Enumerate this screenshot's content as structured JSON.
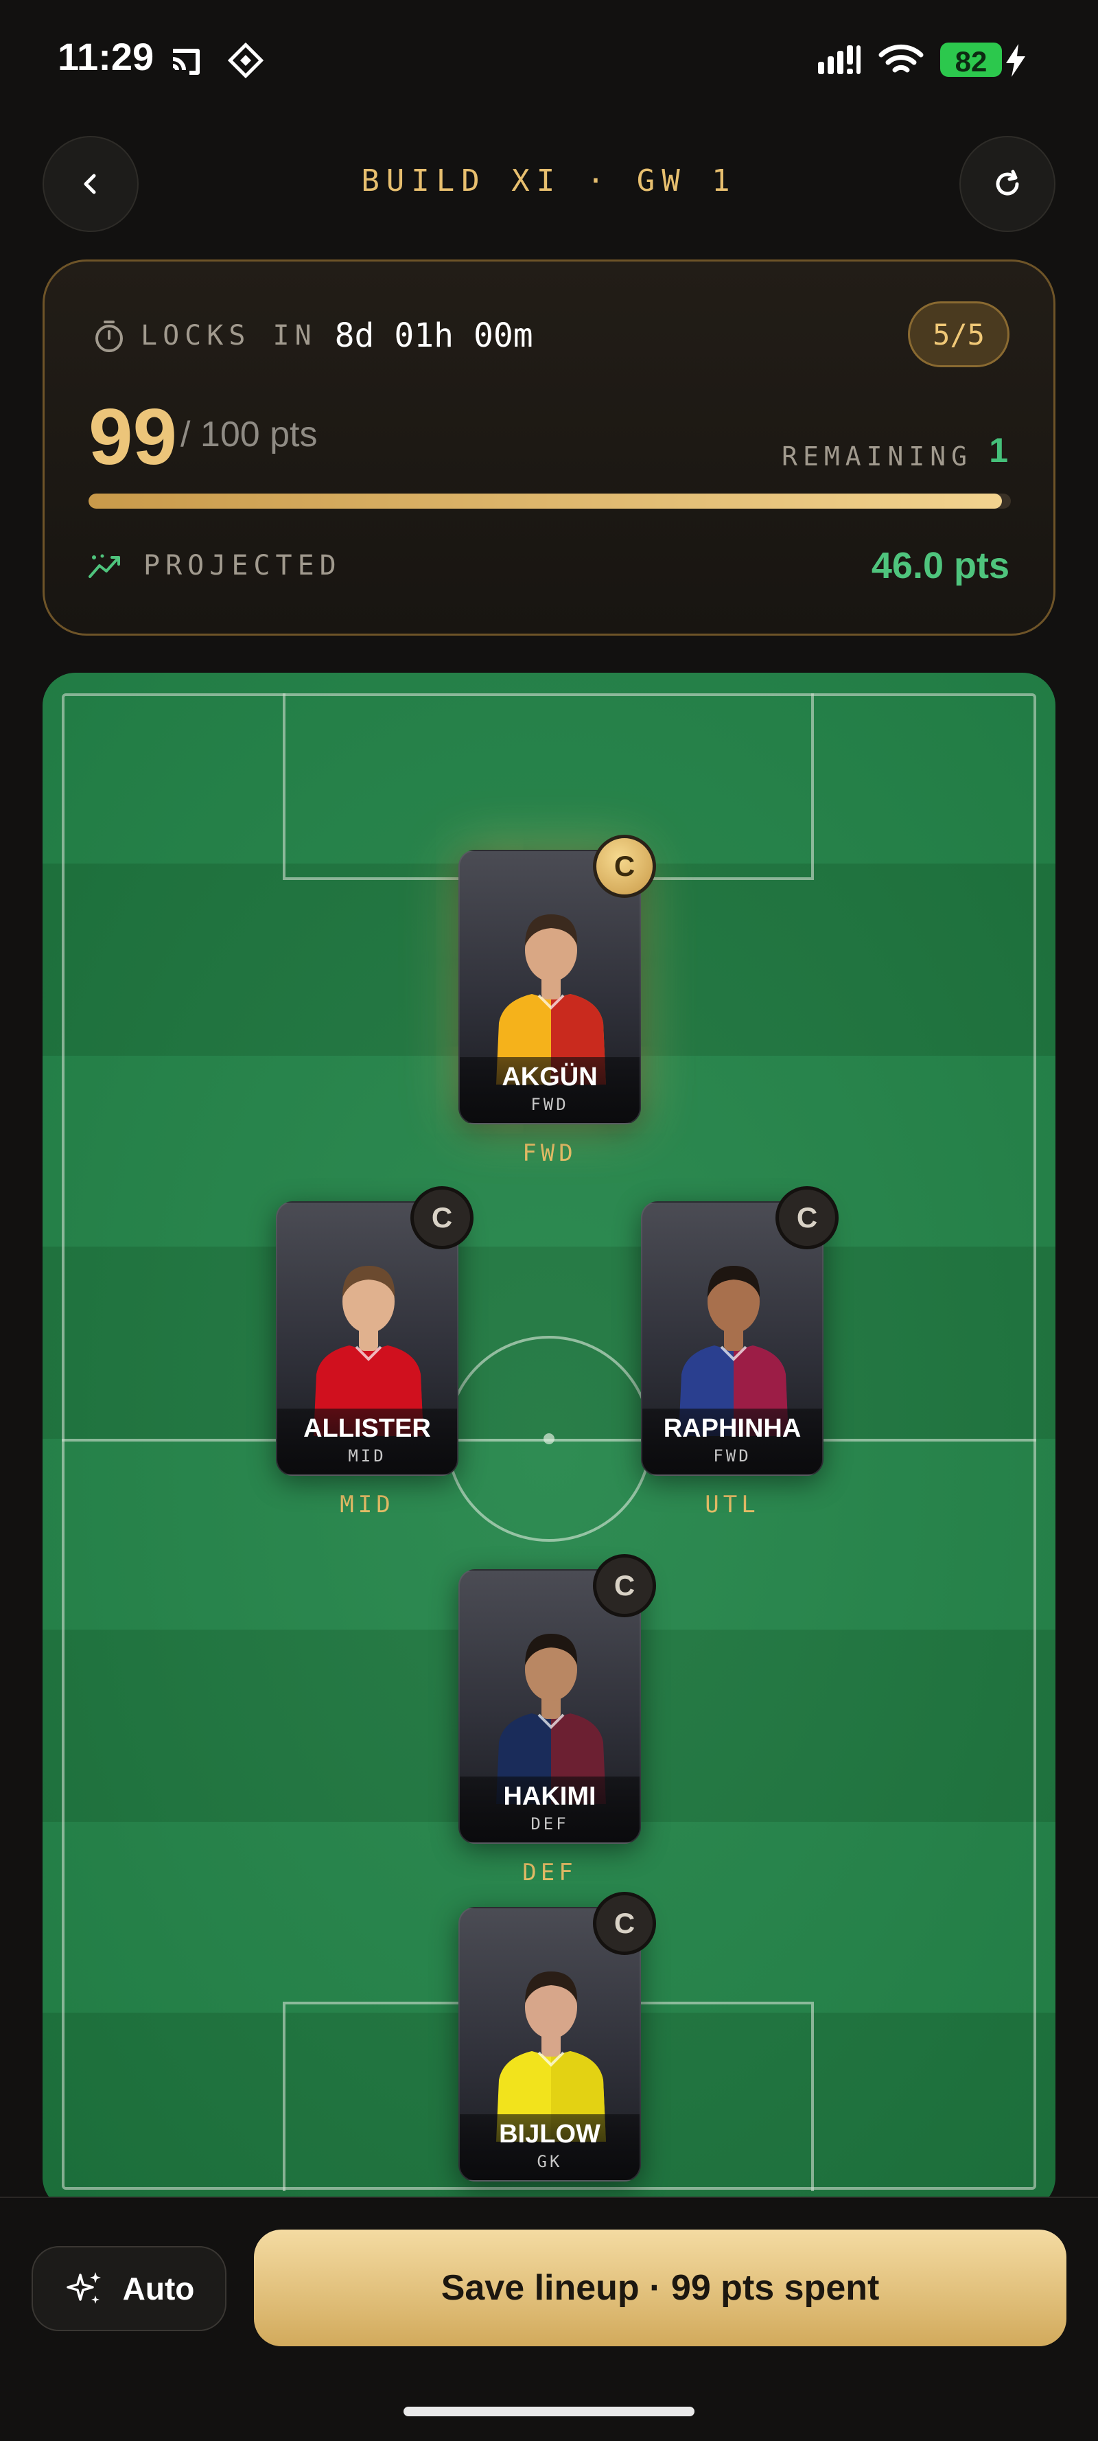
{
  "status_bar": {
    "time": "11:29",
    "battery": "82"
  },
  "header": {
    "title": "BUILD XI · GW 1"
  },
  "info_card": {
    "lock_label": "LOCKS IN",
    "lock_value": "8d 01h 00m",
    "count": "5/5",
    "points_spent": "99",
    "points_cap": "/ 100 pts",
    "budget_fraction": 0.99,
    "remaining_label": "REMAINING",
    "remaining_value": "1",
    "projected_label": "PROJECTED",
    "projected_value": "46.0 pts"
  },
  "players": [
    {
      "name": "AKGÜN",
      "position": "FWD",
      "slot": "FWD",
      "captain_label": "C",
      "is_captain": true,
      "kit": [
        "#f5b21b",
        "#c1121f"
      ],
      "skin": "#d9a784",
      "hair": "#3b2a1e"
    },
    {
      "name": "ALLISTER",
      "position": "MID",
      "slot": "MID",
      "captain_label": "C",
      "is_captain": false,
      "kit": [
        "#d0101e",
        "#d0101e"
      ],
      "skin": "#e0b18e",
      "hair": "#6b4a2f"
    },
    {
      "name": "RAPHINHA",
      "position": "FWD",
      "slot": "UTL",
      "captain_label": "C",
      "is_captain": false,
      "kit": [
        "#2a3f8f",
        "#b0173a"
      ],
      "skin": "#a8704d",
      "hair": "#1e1611"
    },
    {
      "name": "HAKIMI",
      "position": "DEF",
      "slot": "DEF",
      "captain_label": "C",
      "is_captain": false,
      "kit": [
        "#1a2c5a",
        "#7b1e2b"
      ],
      "skin": "#b98763",
      "hair": "#1e1611"
    },
    {
      "name": "BIJLOW",
      "position": "GK",
      "slot": "",
      "captain_label": "C",
      "is_captain": false,
      "kit": [
        "#f2e31c",
        "#e0cf12"
      ],
      "skin": "#d7a68a",
      "hair": "#2a1e16"
    }
  ],
  "footer": {
    "auto_label": "Auto",
    "save_label": "Save lineup · 99 pts spent"
  },
  "colors": {
    "accent_gold": "#e7bf6f",
    "positive_green": "#4fc47d",
    "pitch_green": "#24864a"
  },
  "icons": [
    "back-chevron-icon",
    "refresh-icon",
    "timer-icon",
    "trend-up-icon",
    "sparkles-icon"
  ]
}
